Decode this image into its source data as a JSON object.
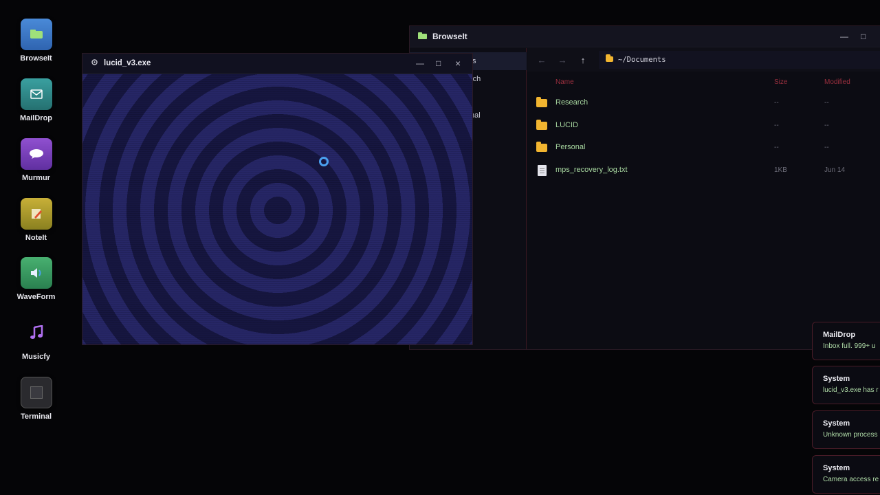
{
  "desktop_icons": [
    {
      "label": "BrowseIt",
      "icon": "browser-icon",
      "color": "#3a78c8"
    },
    {
      "label": "MailDrop",
      "icon": "mail-icon",
      "color": "#2f8a8a"
    },
    {
      "label": "Murmur",
      "icon": "chat-bubble-icon",
      "color": "#7a3fb8"
    },
    {
      "label": "NoteIt",
      "icon": "note-pencil-icon",
      "color": "#b8a030"
    },
    {
      "label": "WaveForm",
      "icon": "speaker-icon",
      "color": "#3aa060"
    },
    {
      "label": "Musicfy",
      "icon": "music-note-icon",
      "color": "#9a5ad8"
    },
    {
      "label": "Terminal",
      "icon": "terminal-icon",
      "color": "#2a2a2e"
    }
  ],
  "browse": {
    "title": "BrowseIt",
    "sidebar": [
      "ts",
      "rch",
      "",
      "nal"
    ],
    "path": "~/Documents",
    "nav": {
      "back": "←",
      "forward": "→",
      "up": "↑"
    },
    "columns": {
      "name": "Name",
      "size": "Size",
      "modified": "Modified"
    },
    "rows": [
      {
        "name": "Research",
        "size": "--",
        "modified": "--",
        "type": "folder"
      },
      {
        "name": "LUCID",
        "size": "--",
        "modified": "--",
        "type": "folder"
      },
      {
        "name": "Personal",
        "size": "--",
        "modified": "--",
        "type": "folder"
      },
      {
        "name": "mps_recovery_log.txt",
        "size": "1KB",
        "modified": "Jun 14",
        "type": "file"
      }
    ],
    "controls": {
      "minimize": "—",
      "maximize": "□"
    }
  },
  "lucid": {
    "title": "lucid_v3.exe",
    "controls": {
      "minimize": "—",
      "maximize": "□",
      "close": "×"
    }
  },
  "notifications": [
    {
      "title": "MailDrop",
      "body": "Inbox full. 999+ u"
    },
    {
      "title": "System",
      "body": "lucid_v3.exe has r"
    },
    {
      "title": "System",
      "body": "Unknown process"
    },
    {
      "title": "System",
      "body": "Camera access re"
    }
  ]
}
